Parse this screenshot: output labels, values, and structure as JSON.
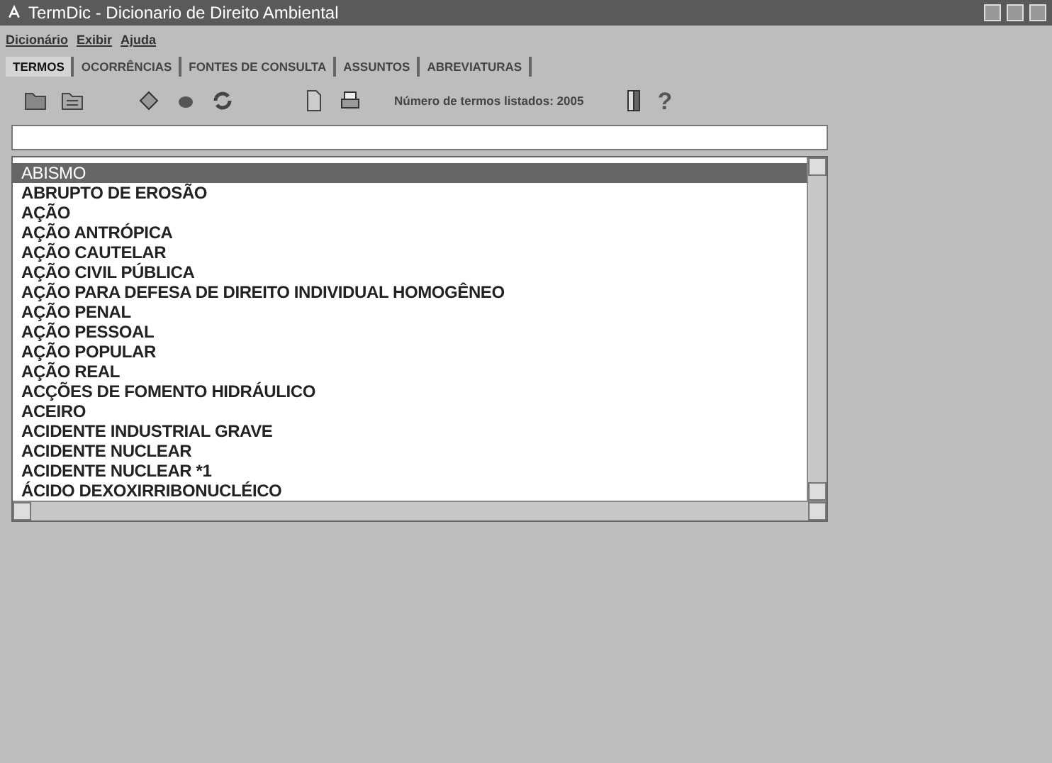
{
  "window": {
    "title": "TermDic - Dicionario de Direito Ambiental"
  },
  "menu": [
    "Dicionário",
    "Exibir",
    "Ajuda"
  ],
  "tabs": [
    {
      "label": "TERMOS",
      "selected": true
    },
    {
      "label": "OCORRÊNCIAS",
      "selected": false
    },
    {
      "label": "FONTES DE CONSULTA",
      "selected": false
    },
    {
      "label": "ASSUNTOS",
      "selected": false
    },
    {
      "label": "ABREVIATURAS",
      "selected": false
    }
  ],
  "toolbar": {
    "count_label": "Número de termos listados: 2005",
    "help": "?"
  },
  "terms": [
    {
      "label": "ABISMO",
      "selected": true
    },
    {
      "label": "ABRUPTO DE EROSÃO",
      "selected": false
    },
    {
      "label": "AÇÃO",
      "selected": false
    },
    {
      "label": "AÇÃO ANTRÓPICA",
      "selected": false
    },
    {
      "label": "AÇÃO CAUTELAR",
      "selected": false
    },
    {
      "label": "AÇÃO CIVIL PÚBLICA",
      "selected": false
    },
    {
      "label": "AÇÃO PARA DEFESA DE DIREITO INDIVIDUAL HOMOGÊNEO",
      "selected": false
    },
    {
      "label": "AÇÃO PENAL",
      "selected": false
    },
    {
      "label": "AÇÃO PESSOAL",
      "selected": false
    },
    {
      "label": "AÇÃO POPULAR",
      "selected": false
    },
    {
      "label": "AÇÃO REAL",
      "selected": false
    },
    {
      "label": "ACÇÕES DE FOMENTO HIDRÁULICO",
      "selected": false
    },
    {
      "label": "ACEIRO",
      "selected": false
    },
    {
      "label": "ACIDENTE INDUSTRIAL GRAVE",
      "selected": false
    },
    {
      "label": "ACIDENTE NUCLEAR",
      "selected": false
    },
    {
      "label": "ACIDENTE NUCLEAR *1",
      "selected": false
    },
    {
      "label": "ÁCIDO DEXOXIRRIBONUCLÉICO",
      "selected": false
    }
  ]
}
